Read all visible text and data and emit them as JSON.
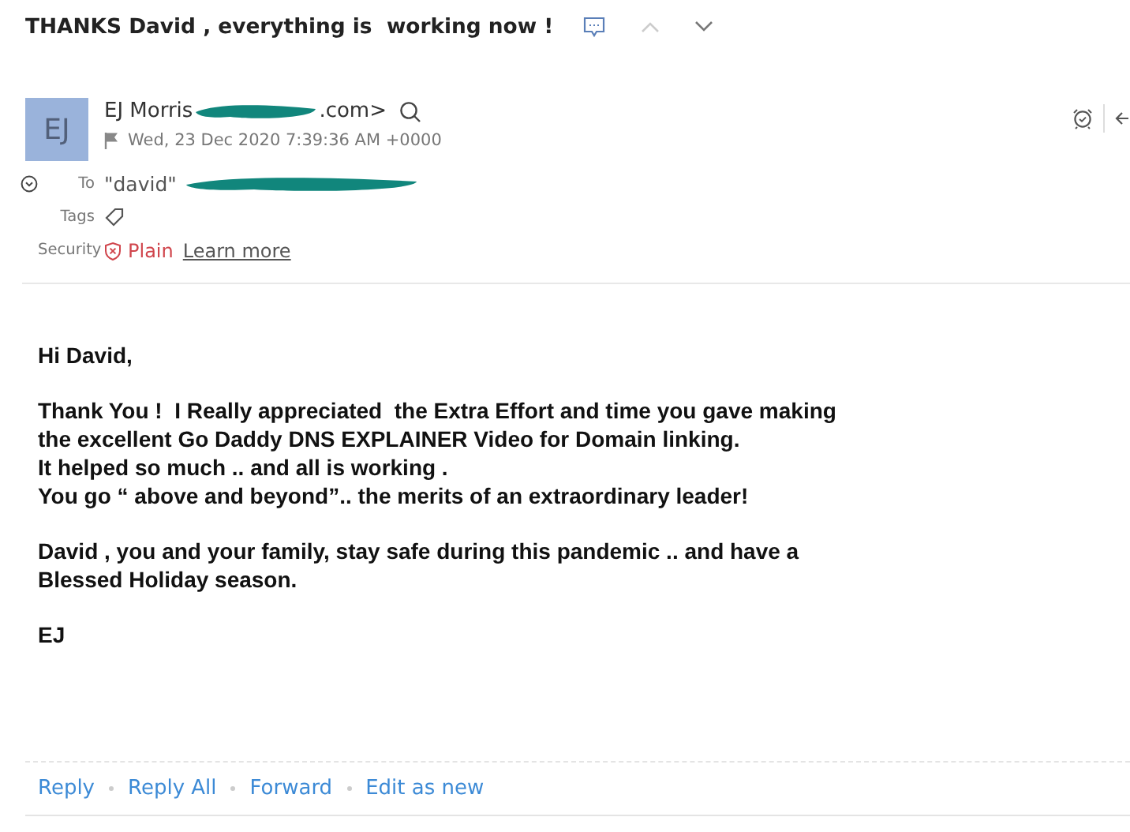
{
  "subject": "THANKS David , everything is  working now !",
  "sender": {
    "avatar": "EJ",
    "name": "EJ Morris",
    "address_tail": ".com>",
    "date": "Wed, 23 Dec 2020 7:39:36 AM +0000",
    "flagged": false
  },
  "fields": [
    {
      "kind": "to",
      "label": "To",
      "value": "\"david\""
    },
    {
      "kind": "tags",
      "label": "Tags"
    },
    {
      "kind": "security",
      "label": "Security",
      "value": "Plain",
      "link": "Learn more"
    }
  ],
  "body": [
    [
      "Hi David,"
    ],
    [
      "Thank You !  I Really appreciated  the Extra Effort and time you gave making",
      "the excellent Go Daddy DNS EXPLAINER Video for Domain linking.",
      "It helped so much .. and all is working .",
      "You go “ above and beyond”.. the merits of an extraordinary leader!"
    ],
    [
      "David , you and your family, stay safe during this pandemic .. and have a",
      "Blessed Holiday season."
    ],
    [
      "EJ"
    ]
  ],
  "actions": [
    "Reply",
    "Reply All",
    "Forward",
    "Edit as new"
  ]
}
